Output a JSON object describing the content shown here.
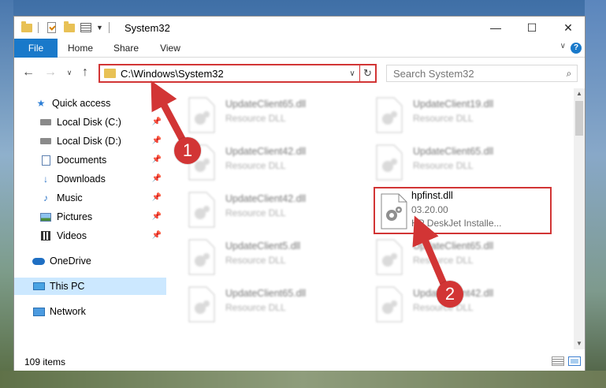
{
  "window": {
    "title": "System32",
    "controls": {
      "minimize": "—",
      "maximize": "☐",
      "close": "✕"
    }
  },
  "ribbon": {
    "tabs": [
      {
        "label": "File",
        "active": true
      },
      {
        "label": "Home"
      },
      {
        "label": "Share"
      },
      {
        "label": "View"
      }
    ],
    "help": "?"
  },
  "navbar": {
    "address": "C:\\Windows\\System32",
    "search_placeholder": "Search System32"
  },
  "sidebar": {
    "items": [
      {
        "label": "Quick access",
        "icon": "star-icon",
        "pinned": false
      },
      {
        "label": "Local Disk (C:)",
        "icon": "drive-icon",
        "pinned": true
      },
      {
        "label": "Local Disk (D:)",
        "icon": "drive-icon",
        "pinned": true
      },
      {
        "label": "Documents",
        "icon": "documents-icon",
        "pinned": true
      },
      {
        "label": "Downloads",
        "icon": "downloads-icon",
        "pinned": true
      },
      {
        "label": "Music",
        "icon": "music-icon",
        "pinned": true
      },
      {
        "label": "Pictures",
        "icon": "pictures-icon",
        "pinned": true
      },
      {
        "label": "Videos",
        "icon": "videos-icon",
        "pinned": true
      },
      {
        "label": "OneDrive",
        "icon": "onedrive-icon"
      },
      {
        "label": "This PC",
        "icon": "this-pc-icon",
        "selected": true
      },
      {
        "label": "Network",
        "icon": "network-icon"
      }
    ]
  },
  "files": [
    {
      "name": "UpdateClient65.dll",
      "type": "Resource DLL",
      "blurred": true
    },
    {
      "name": "UpdateClient19.dll",
      "type": "Resource DLL",
      "blurred": true
    },
    {
      "name": "UpdateClient42.dll",
      "type": "Resource DLL",
      "blurred": true
    },
    {
      "name": "UpdateClient65.dll",
      "type": "Resource DLL",
      "blurred": true
    },
    {
      "name": "UpdateClient42.dll",
      "type": "Resource DLL",
      "blurred": true
    },
    {
      "name": "hpfinst.dll",
      "version": "03.20.00",
      "description": "HP DeskJet Installe...",
      "highlighted": true
    },
    {
      "name": "UpdateClient5.dll",
      "type": "Resource DLL",
      "blurred": true
    },
    {
      "name": "UpdateClient65.dll",
      "type": "Resource DLL",
      "blurred": true
    },
    {
      "name": "UpdateClient65.dll",
      "type": "Resource DLL",
      "blurred": true
    },
    {
      "name": "UpdateClient42.dll",
      "type": "Resource DLL",
      "blurred": true
    }
  ],
  "status": {
    "item_count": "109 items"
  },
  "annotations": {
    "step1": "1",
    "step2": "2",
    "color": "#d23535"
  }
}
